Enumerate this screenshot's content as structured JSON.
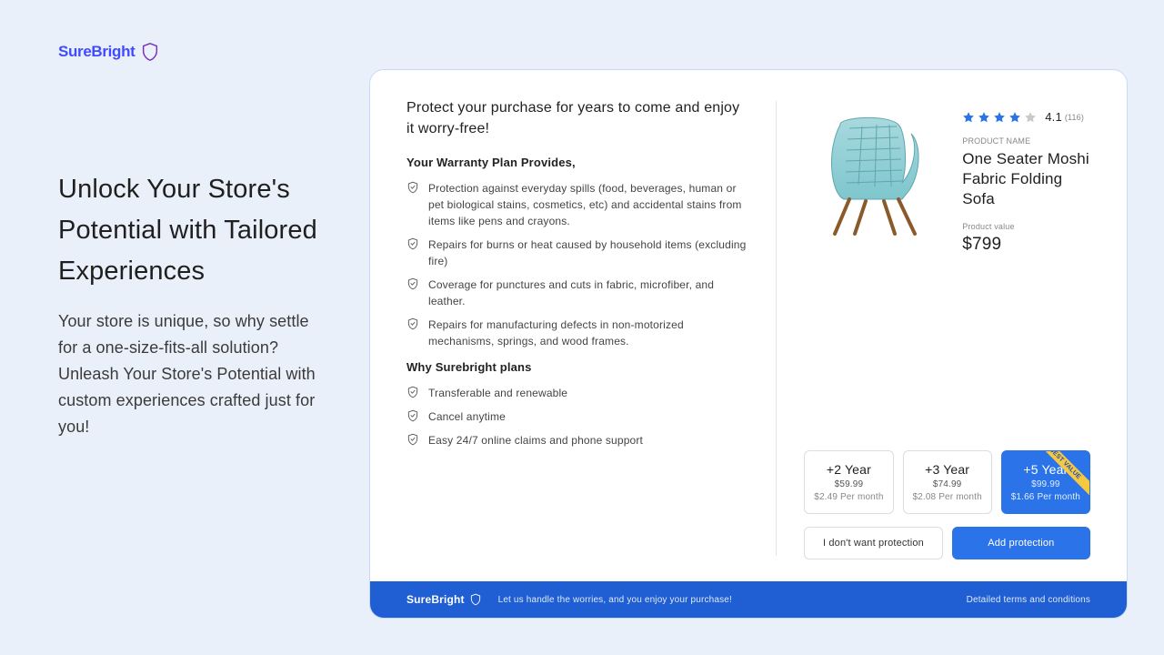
{
  "brand": "SureBright",
  "hero": {
    "title": "Unlock Your Store's Potential with Tailored Experiences",
    "body": "Your store is unique, so why settle for a one-size-fits-all solution? Unleash Your Store's Potential with custom experiences crafted just for you!"
  },
  "widget": {
    "title": "Protect your purchase for years to come and enjoy it worry-free!",
    "provides_heading": "Your Warranty Plan Provides,",
    "provides": [
      "Protection against everyday spills (food, beverages, human or pet biological stains, cosmetics, etc) and accidental stains from items like pens and crayons.",
      "Repairs for burns or heat caused by household items (excluding fire)",
      "Coverage for punctures and cuts in fabric, microfiber, and leather.",
      "Repairs for manufacturing defects in non-motorized mechanisms, springs, and wood frames."
    ],
    "why_heading": "Why Surebright plans",
    "why": [
      "Transferable and renewable",
      "Cancel anytime",
      "Easy 24/7 online claims and phone support"
    ]
  },
  "product": {
    "rating": "4.1",
    "rating_count": "(116)",
    "name_label": "PRODUCT NAME",
    "name": "One Seater Moshi Fabric Folding Sofa",
    "value_label": "Product value",
    "value": "$799"
  },
  "plans": [
    {
      "duration": "+2 Year",
      "price": "$59.99",
      "per_month": "$2.49 Per month",
      "best": false
    },
    {
      "duration": "+3 Year",
      "price": "$74.99",
      "per_month": "$2.08 Per month",
      "best": false
    },
    {
      "duration": "+5 Year",
      "price": "$99.99",
      "per_month": "$1.66 Per month",
      "best": true
    }
  ],
  "best_value_label": "BEST VALUE",
  "cta": {
    "decline": "I don't want protection",
    "accept": "Add protection"
  },
  "footer": {
    "tagline": "Let us handle the worries, and you enjoy your purchase!",
    "link": "Detailed terms and conditions"
  }
}
